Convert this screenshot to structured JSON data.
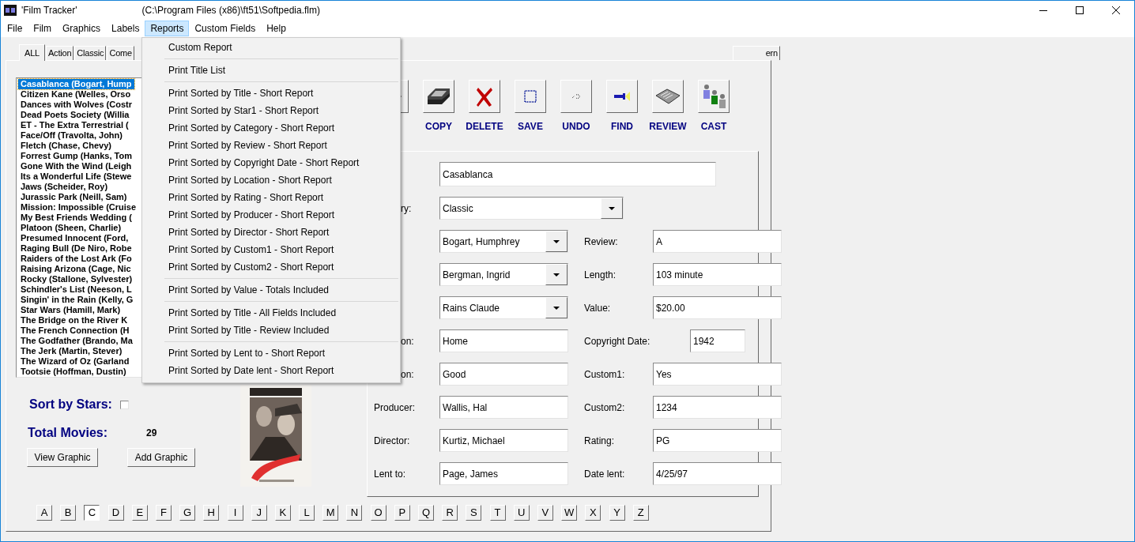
{
  "window": {
    "title": "'Film Tracker'",
    "file_path": "(C:\\Program Files (x86)\\ft51\\Softpedia.flm)"
  },
  "menu_bar": [
    {
      "label": "File",
      "selected": false
    },
    {
      "label": "Film",
      "selected": false
    },
    {
      "label": "Graphics",
      "selected": false
    },
    {
      "label": "Labels",
      "selected": false
    },
    {
      "label": "Reports",
      "selected": true
    },
    {
      "label": "Custom Fields",
      "selected": false
    },
    {
      "label": "Help",
      "selected": false
    }
  ],
  "reports_menu": [
    {
      "kind": "item",
      "label": "Custom Report"
    },
    {
      "kind": "separator"
    },
    {
      "kind": "item",
      "label": "Print Title List"
    },
    {
      "kind": "separator"
    },
    {
      "kind": "item",
      "label": "Print Sorted by Title - Short Report"
    },
    {
      "kind": "item",
      "label": "Print Sorted by Star1 - Short Report"
    },
    {
      "kind": "item",
      "label": "Print Sorted by Category - Short Report"
    },
    {
      "kind": "item",
      "label": "Print Sorted by Review - Short Report"
    },
    {
      "kind": "item",
      "label": "Print Sorted by Copyright Date - Short Report"
    },
    {
      "kind": "item",
      "label": "Print Sorted by Location - Short Report"
    },
    {
      "kind": "item",
      "label": "Print Sorted by Rating - Short Report"
    },
    {
      "kind": "item",
      "label": "Print Sorted by Producer - Short Report"
    },
    {
      "kind": "item",
      "label": "Print Sorted by Director - Short Report"
    },
    {
      "kind": "item",
      "label": "Print Sorted by Custom1 - Short Report"
    },
    {
      "kind": "item",
      "label": "Print Sorted by Custom2 - Short Report"
    },
    {
      "kind": "separator"
    },
    {
      "kind": "item",
      "label": "Print Sorted by Value - Totals Included"
    },
    {
      "kind": "separator"
    },
    {
      "kind": "item",
      "label": "Print Sorted by Title - All Fields Included"
    },
    {
      "kind": "item",
      "label": "Print Sorted by Title - Review Included"
    },
    {
      "kind": "separator"
    },
    {
      "kind": "item",
      "label": "Print Sorted by Lent to - Short Report"
    },
    {
      "kind": "item",
      "label": "Print Sorted by Date lent - Short Report"
    }
  ],
  "tabs": [
    {
      "label": "ALL",
      "selected": true
    },
    {
      "label": "Action",
      "selected": false
    },
    {
      "label": "Classic",
      "selected": false
    },
    {
      "label": "Come",
      "selected": false
    },
    {
      "label": "ern",
      "selected": false
    }
  ],
  "film_list": [
    {
      "label": "Casablanca (Bogart, Hump",
      "selected": true
    },
    {
      "label": "Citizen Kane (Welles, Orso",
      "selected": false
    },
    {
      "label": "Dances with Wolves (Costr",
      "selected": false
    },
    {
      "label": "Dead Poets Society (Willia",
      "selected": false
    },
    {
      "label": "ET - The Extra Terrestrial (",
      "selected": false
    },
    {
      "label": "Face/Off (Travolta, John)",
      "selected": false
    },
    {
      "label": "Fletch (Chase, Chevy)",
      "selected": false
    },
    {
      "label": "Forrest Gump (Hanks, Tom",
      "selected": false
    },
    {
      "label": "Gone With the Wind (Leigh",
      "selected": false
    },
    {
      "label": "Its a Wonderful Life (Stewe",
      "selected": false
    },
    {
      "label": "Jaws (Scheider, Roy)",
      "selected": false
    },
    {
      "label": "Jurassic Park (Neill, Sam)",
      "selected": false
    },
    {
      "label": "Mission: Impossible (Cruise",
      "selected": false
    },
    {
      "label": "My Best Friends Wedding (",
      "selected": false
    },
    {
      "label": "Platoon (Sheen, Charlie)",
      "selected": false
    },
    {
      "label": "Presumed Innocent (Ford,",
      "selected": false
    },
    {
      "label": "Raging Bull (De Niro, Robe",
      "selected": false
    },
    {
      "label": "Raiders of the Lost Ark (Fo",
      "selected": false
    },
    {
      "label": "Raising Arizona (Cage, Nic",
      "selected": false
    },
    {
      "label": "Rocky (Stallone, Sylvester)",
      "selected": false
    },
    {
      "label": "Schindler's List (Neeson, L",
      "selected": false
    },
    {
      "label": "Singin' in the Rain (Kelly, G",
      "selected": false
    },
    {
      "label": "Star Wars (Hamill, Mark)",
      "selected": false
    },
    {
      "label": "The Bridge on the River K",
      "selected": false
    },
    {
      "label": "The French Connection (H",
      "selected": false
    },
    {
      "label": "The Godfather (Brando, Ma",
      "selected": false
    },
    {
      "label": "The Jerk (Martin, Stever)",
      "selected": false
    },
    {
      "label": "The Wizard of Oz (Garland",
      "selected": false
    },
    {
      "label": "Tootsie (Hoffman, Dustin)",
      "selected": false
    }
  ],
  "toolbar": [
    {
      "kind": "arrow"
    },
    {
      "kind": "copy",
      "label": "COPY"
    },
    {
      "kind": "delete",
      "label": "DELETE"
    },
    {
      "kind": "save",
      "label": "SAVE"
    },
    {
      "kind": "undo",
      "label": "UNDO"
    },
    {
      "kind": "find",
      "label": "FIND"
    },
    {
      "kind": "review",
      "label": "REVIEW"
    },
    {
      "kind": "cast",
      "label": "CAST"
    }
  ],
  "form_rows": [
    {
      "left": {
        "kind": "wide_text",
        "value": "Casablanca"
      }
    },
    {
      "left": {
        "kind": "wide_select",
        "label": "ry:",
        "cut": true,
        "value": "Classic"
      }
    },
    {
      "left": {
        "kind": "select",
        "value": "Bogart, Humphrey"
      },
      "right": {
        "kind": "text",
        "label": "Review:",
        "value": "A"
      }
    },
    {
      "left": {
        "kind": "select",
        "value": "Bergman, Ingrid"
      },
      "right": {
        "kind": "text",
        "label": "Length:",
        "value": "103 minute"
      }
    },
    {
      "left": {
        "kind": "select",
        "value": "Rains Claude"
      },
      "right": {
        "kind": "text",
        "label": "Value:",
        "value": "$20.00"
      }
    },
    {
      "left": {
        "kind": "text",
        "label": "on:",
        "cut": true,
        "value": "Home"
      },
      "right": {
        "kind": "short",
        "label": "Copyright Date:",
        "value": "1942"
      }
    },
    {
      "left": {
        "kind": "text",
        "label": "on:",
        "cut": true,
        "value": "Good"
      },
      "right": {
        "kind": "text",
        "label": "Custom1:",
        "value": "Yes"
      }
    },
    {
      "left": {
        "kind": "text",
        "label": "Producer:",
        "value": "Wallis, Hal"
      },
      "right": {
        "kind": "text",
        "label": "Custom2:",
        "value": "1234"
      }
    },
    {
      "left": {
        "kind": "text",
        "label": "Director:",
        "value": "Kurtiz, Michael"
      },
      "right": {
        "kind": "text",
        "label": "Rating:",
        "value": "PG"
      }
    },
    {
      "left": {
        "kind": "text",
        "label": "Lent to:",
        "value": "Page, James"
      },
      "right": {
        "kind": "text",
        "label": "Date lent:",
        "value": "4/25/97"
      }
    }
  ],
  "sort_by_stars": {
    "label": "Sort by Stars:",
    "checked": false
  },
  "total_movies": {
    "label": "Total Movies:",
    "value": "29"
  },
  "buttons": [
    "View Graphic",
    "Add Graphic"
  ],
  "letters": [
    {
      "label": "A",
      "selected": false
    },
    {
      "label": "B",
      "selected": false
    },
    {
      "label": "C",
      "selected": true
    },
    {
      "label": "D",
      "selected": false
    },
    {
      "label": "E",
      "selected": false
    },
    {
      "label": "F",
      "selected": false
    },
    {
      "label": "G",
      "selected": false
    },
    {
      "label": "H",
      "selected": false
    },
    {
      "label": "I",
      "selected": false
    },
    {
      "label": "J",
      "selected": false
    },
    {
      "label": "K",
      "selected": false
    },
    {
      "label": "L",
      "selected": false
    },
    {
      "label": "M",
      "selected": false
    },
    {
      "label": "N",
      "selected": false
    },
    {
      "label": "O",
      "selected": false
    },
    {
      "label": "P",
      "selected": false
    },
    {
      "label": "Q",
      "selected": false
    },
    {
      "label": "R",
      "selected": false
    },
    {
      "label": "S",
      "selected": false
    },
    {
      "label": "T",
      "selected": false
    },
    {
      "label": "U",
      "selected": false
    },
    {
      "label": "V",
      "selected": false
    },
    {
      "label": "W",
      "selected": false
    },
    {
      "label": "X",
      "selected": false
    },
    {
      "label": "Y",
      "selected": false
    },
    {
      "label": "Z",
      "selected": false
    }
  ]
}
